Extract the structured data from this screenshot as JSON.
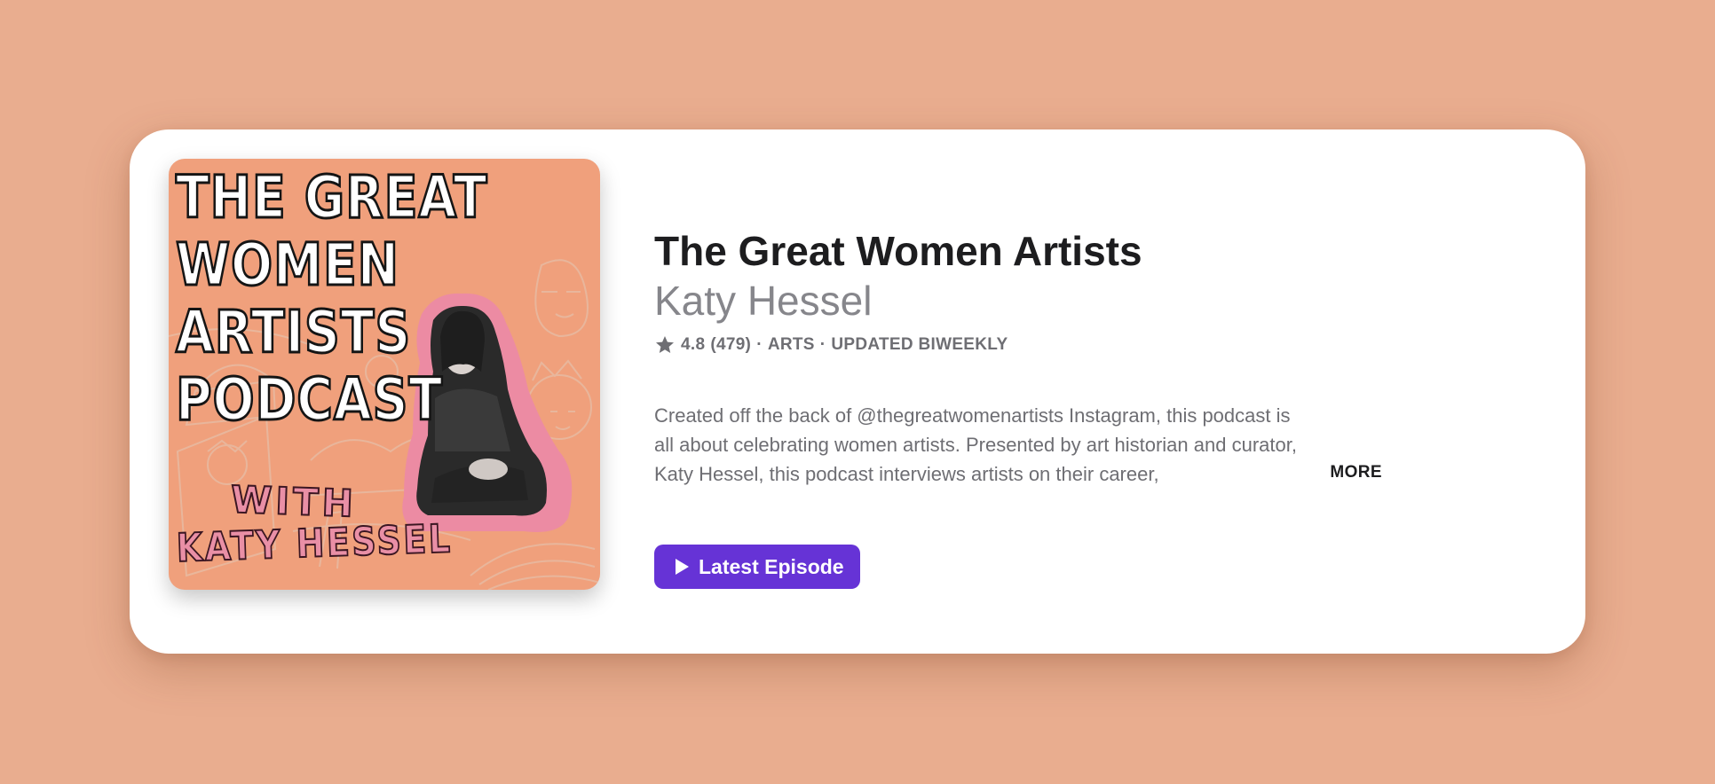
{
  "colors": {
    "background": "#E9AD8F",
    "card": "#ffffff",
    "accent": "#6633D6",
    "artwork_bg": "#F0A07C",
    "title_text": "#1d1d1f",
    "secondary_text": "#86868b"
  },
  "artwork": {
    "title_lines": "THE GREAT\nWOMEN ARTISTS\nPODCAST",
    "with": "WITH",
    "host": "KATY HESSEL"
  },
  "podcast": {
    "title": "The Great Women Artists",
    "author": "Katy Hessel",
    "rating_icon": "star-icon",
    "rating": "4.8",
    "rating_count": "(479)",
    "separator": "·",
    "category": "ARTS",
    "frequency": "UPDATED BIWEEKLY",
    "description": "Created off the back of @thegreatwomenartists Instagram, this podcast is all about celebrating women artists. Presented by art historian and curator, Katy Hessel, this podcast interviews artists on their career,",
    "more_label": "MORE"
  },
  "actions": {
    "latest_icon": "play-icon",
    "latest_label": "Latest Episode"
  }
}
